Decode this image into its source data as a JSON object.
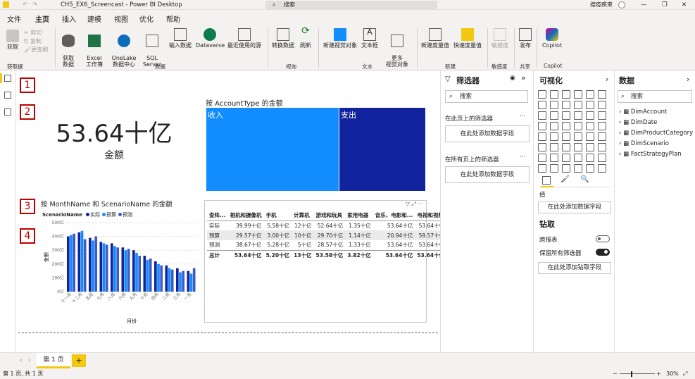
{
  "window": {
    "title": "CH5_EX6_Screencast - Power BI Desktop",
    "search": "搜索",
    "user": "搜疫疾束"
  },
  "menu": [
    "文件",
    "主页",
    "插入",
    "建模",
    "视图",
    "优化",
    "帮助"
  ],
  "ribbon": {
    "clipboard": {
      "paste": "获取",
      "cut": "剪切",
      "copy": "复制",
      "format": "更变刷",
      "group": "获取据"
    },
    "data": {
      "get": "获取\n数据",
      "excel": "Excel\n工作簿",
      "onelake": "OneLake\n数据中心",
      "sql": "SQL\nServer",
      "enter": "输入数据",
      "dataverse": "Dataverse",
      "recent": "最近使用的源",
      "group": "数据"
    },
    "queries": {
      "transform": "转换数据",
      "refresh": "刷新",
      "group": "视询"
    },
    "insert": {
      "visual": "新建视觉对象",
      "textbox": "文本框",
      "more": "更多\n视觉对象",
      "group": "文本"
    },
    "calc": {
      "measure": "新建度量值",
      "quick": "快速度量值",
      "group": "新建"
    },
    "sensitivity": {
      "label": "敏感度",
      "group": "敏感度"
    },
    "share": {
      "publish": "发布",
      "group": "共享"
    },
    "copilot": {
      "label": "Copilot",
      "group": "Copilot"
    }
  },
  "markers": [
    "1",
    "2",
    "3",
    "4"
  ],
  "card": {
    "value": "53.64十亿",
    "label": "金额"
  },
  "treemap": {
    "title": "按 AccountType 的金额",
    "tiles": [
      "收入",
      "支出"
    ],
    "colors": [
      "#118dff",
      "#12239e"
    ]
  },
  "chart_data": {
    "type": "bar",
    "title": "按 MonthName 和 ScenarioName 的金额",
    "legend_title": "ScenarioName",
    "xlabel": "月份",
    "ylabel": "金额",
    "ylim": [
      0,
      500
    ],
    "yticks": [
      "0亿",
      "100亿",
      "200亿",
      "300亿",
      "400亿",
      "500亿"
    ],
    "categories": [
      "十一月",
      "十二月",
      "五月",
      "七月",
      "八月",
      "六月",
      "九月",
      "十月",
      "四月",
      "二月",
      "三月",
      "一月"
    ],
    "series": [
      {
        "name": "实际",
        "color": "#12239e",
        "values": [
          400,
          430,
          390,
          360,
          350,
          320,
          300,
          260,
          220,
          190,
          170,
          150
        ]
      },
      {
        "name": "预算",
        "color": "#118dff",
        "values": [
          410,
          440,
          370,
          350,
          330,
          300,
          280,
          230,
          200,
          170,
          140,
          130
        ]
      },
      {
        "name": "预测",
        "color": "#3d5ac9",
        "values": [
          420,
          380,
          400,
          340,
          320,
          310,
          260,
          240,
          190,
          160,
          150,
          170
        ]
      }
    ]
  },
  "matrix": {
    "headers": [
      "查阵...",
      "相机和摄像机",
      "手机",
      "计算机",
      "游戏和玩具",
      "家用电器",
      "音乐、电影和...",
      "电视和视频"
    ],
    "rows": [
      [
        "实际",
        "39.99十亿",
        "5.58十亿",
        "12十亿",
        "52.64十亿",
        "1.35十亿",
        "53.64十亿",
        "53.64十亿"
      ],
      [
        "预算",
        "29.57十亿",
        "3.00十亿",
        "10十亿",
        "29.70十亿",
        "1.14十亿",
        "20.94十亿",
        "59.57十亿"
      ],
      [
        "预测",
        "38.67十亿",
        "5.28十亿",
        "5十亿",
        "28.57十亿",
        "1.33十亿",
        "53.64十亿",
        "53.64十亿"
      ]
    ],
    "total": [
      "总计",
      "53.64十亿",
      "5.20十亿",
      "13十亿",
      "53.58十亿",
      "3.82十亿",
      "53.64十亿",
      "53.64十亿"
    ]
  },
  "filters": {
    "title": "筛选器",
    "search": "搜索",
    "page_label": "在此页上的筛选器",
    "all_label": "在所有页上的筛选器",
    "add": "在此处添加数据字段"
  },
  "viz": {
    "title": "可视化",
    "values_label": "值",
    "add_field": "在此处添加数据字段",
    "drill": "钻取",
    "cross_report": "跨报表",
    "keep_filters": "保留所有筛选器",
    "add_drill": "在此处添加钻取字段"
  },
  "fields": {
    "title": "数据",
    "search": "搜索",
    "tables": [
      "DimAccount",
      "DimDate",
      "DimProductCategory",
      "DimScenario",
      "FactStrategyPlan"
    ]
  },
  "pages": {
    "tab": "第 1 页",
    "add": "+"
  },
  "status": {
    "left": "第 1 页, 共 1 页",
    "zoom": "30%"
  }
}
